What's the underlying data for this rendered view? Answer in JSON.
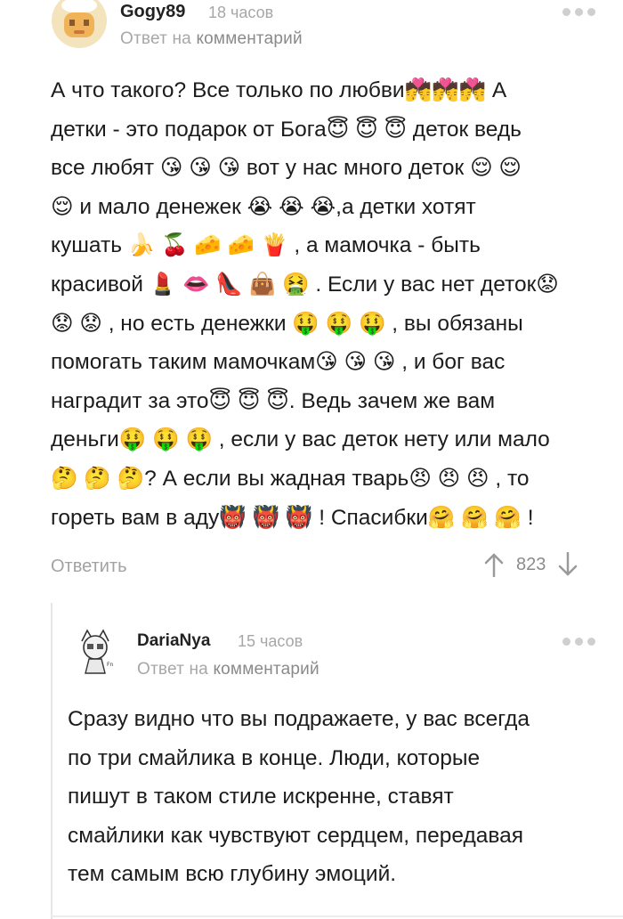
{
  "comment1": {
    "username": "Gogy89",
    "time": "18 часов",
    "reply_prefix": "Ответ на",
    "reply_link": "комментарий",
    "lines": [
      "А что такого? Все только по любви💏💏💏 А",
      "детки - это подарок от Бога😇 😇 😇 деток ведь",
      "все любят 😘 😘 😘  вот у нас много деток 😌 😌",
      "😌 и мало денежек 😭 😭 😭,а детки хотят",
      "кушать 🍌 🍒 🧀 🧀 🍟 , а мамочка - быть",
      "красивой 💄 👄 👠 👜 🤮 . Если у вас нет деток😟",
      "😟 😟 , но есть денежки 🤑 🤑 🤑 , вы обязаны",
      "помогать таким мамочкам😘 😘 😘 , и бог вас",
      "наградит за это😇 😇 😇. Ведь зачем же вам",
      "деньги🤑 🤑 🤑 , если у вас деток нету или мало",
      "🤔 🤔 🤔? А если вы жадная тварь😠 😠 😠 , то",
      "гореть вам в аду👹 👹 👹 ! Спасибки🤗 🤗 🤗 !"
    ],
    "reply_button": "Ответить",
    "rating": "823"
  },
  "comment2": {
    "username": "DariaNya",
    "time": "15 часов",
    "reply_prefix": "Ответ на",
    "reply_link": "комментарий",
    "lines": [
      "Сразу видно что вы подражаете, у вас всегда",
      "по три смайлика в конце. Люди, которые",
      "пишут в таком стиле искренне, ставят",
      "смайлики как чувствуют сердцем, передавая",
      "тем самым всю глубину эмоций."
    ]
  },
  "colors": {
    "meta_gray": "#a7a7a7",
    "text": "#1c1c1c",
    "divider": "#e6e6e6"
  }
}
